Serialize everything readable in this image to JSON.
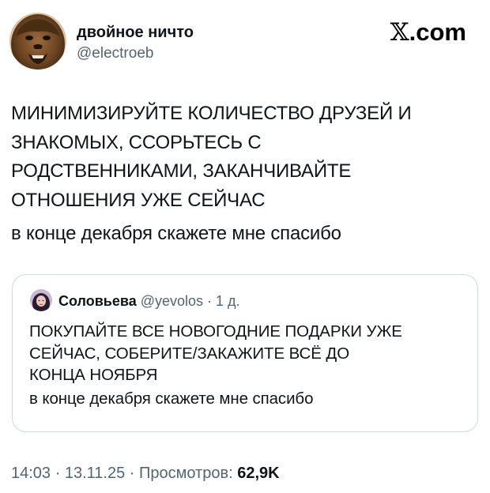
{
  "author": {
    "name": "двойное ничто",
    "handle": "@electroeb"
  },
  "brand": {
    "x": "𝕏",
    "dotcom": ".com"
  },
  "tweet": {
    "text": "МИНИМИЗИРУЙТЕ КОЛИЧЕСТВО ДРУЗЕЙ И\nЗНАКОМЫХ, ССОРЬТЕСЬ С\nРОДСТВЕННИКАМИ, ЗАКАНЧИВАЙТЕ\nОТНОШЕНИЯ УЖЕ СЕЙЧАС",
    "subtext": "в конце декабря скажете мне спасибо"
  },
  "quote": {
    "name": "Соловьева",
    "handle": "@yevolos",
    "separator": " · ",
    "age": "1 д.",
    "text": "ПОКУПАЙТЕ ВСЕ НОВОГОДНИЕ ПОДАРКИ УЖЕ\nСЕЙЧАС, СОБЕРИТЕ/ЗАКАЖИТЕ ВСЁ ДО\nКОНЦА НОЯБРЯ",
    "subtext": "в конце декабря скажете мне спасибо"
  },
  "footer": {
    "time": "14:03",
    "sep1": " · ",
    "date": "13.11.25",
    "sep2": " · ",
    "views_label": "Просмотров: ",
    "views_count": "62,9K"
  }
}
